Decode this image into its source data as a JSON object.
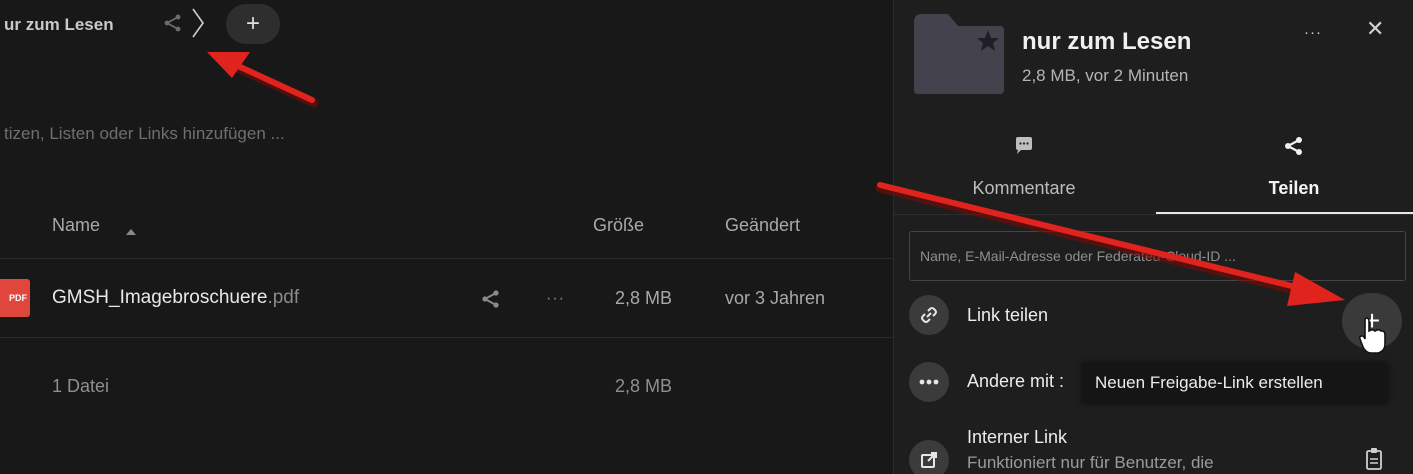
{
  "breadcrumb": {
    "current_folder": "ur zum Lesen",
    "add_button_symbol": "+"
  },
  "notes_placeholder": "tizen, Listen oder Links hinzufügen ...",
  "file_list": {
    "columns": {
      "name": "Name",
      "size": "Größe",
      "modified": "Geändert"
    },
    "rows": [
      {
        "icon_label": "PDF",
        "name": "GMSH_Imagebroschuere",
        "ext": ".pdf",
        "more": "···",
        "size": "2,8 MB",
        "modified": "vor 3 Jahren"
      }
    ],
    "summary": {
      "count": "1 Datei",
      "size": "2,8 MB"
    }
  },
  "sidebar": {
    "title": "nur zum Lesen",
    "subtitle": "2,8 MB, vor 2 Minuten",
    "more": "···",
    "close": "✕",
    "tabs": [
      {
        "label": "Kommentare",
        "icon": "comment-icon",
        "active": false
      },
      {
        "label": "Teilen",
        "icon": "share-icon",
        "active": true
      }
    ],
    "share_input_placeholder": "Name, E-Mail-Adresse oder Federated-Cloud-ID ...",
    "entries": {
      "link_share": "Link teilen",
      "others_share": "Andere mit :",
      "internal_link": "Interner Link",
      "internal_link_sub": "Funktioniert nur für Benutzer, die"
    },
    "add_link_symbol": "+",
    "tooltip": "Neuen Freigabe-Link erstellen"
  },
  "colors": {
    "background": "#181818",
    "sidebar": "#1e1e1e",
    "pdf_red": "#e0463c",
    "annotation_arrow": "#e0231c"
  }
}
